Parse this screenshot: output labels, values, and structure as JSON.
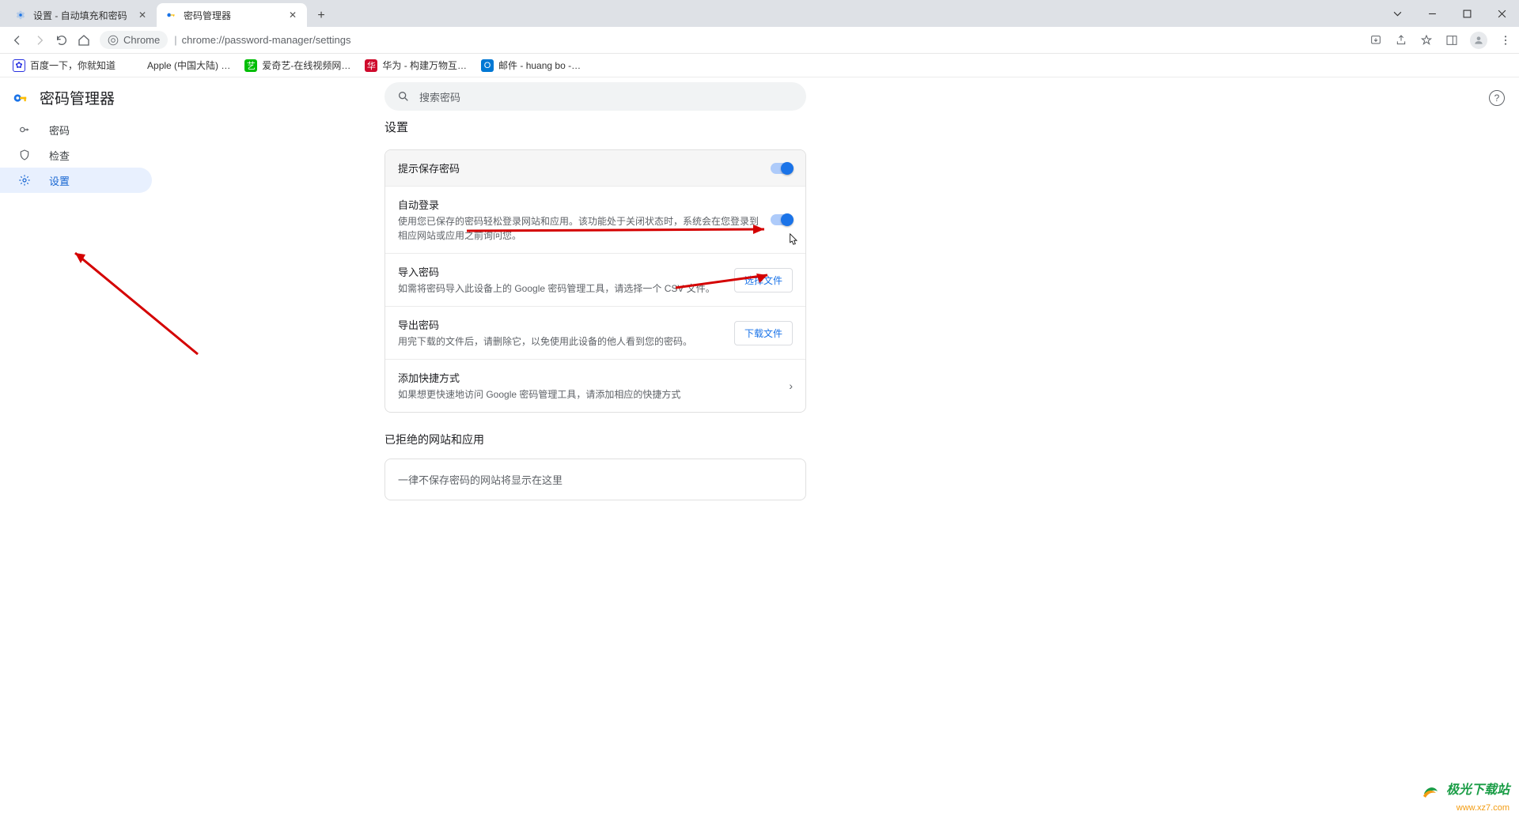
{
  "tabs": [
    {
      "title": "设置 - 自动填充和密码",
      "active": false
    },
    {
      "title": "密码管理器",
      "active": true
    }
  ],
  "omnibox": {
    "chip": "Chrome",
    "url": "chrome://password-manager/settings"
  },
  "bookmarks": [
    {
      "label": "百度一下，你就知道",
      "color": "#2932e1"
    },
    {
      "label": "Apple (中国大陆) …",
      "color": "#999"
    },
    {
      "label": "爱奇艺-在线视频网…",
      "color": "#00be06"
    },
    {
      "label": "华为 - 构建万物互…",
      "color": "#cf0a2c"
    },
    {
      "label": "邮件 - huang bo -…",
      "color": "#0078d4"
    }
  ],
  "app": {
    "title": "密码管理器"
  },
  "search": {
    "placeholder": "搜索密码"
  },
  "sidebar": {
    "items": [
      {
        "label": "密码",
        "icon": "key"
      },
      {
        "label": "检查",
        "icon": "shield"
      },
      {
        "label": "设置",
        "icon": "gear",
        "active": true
      }
    ]
  },
  "main": {
    "section_title": "设置",
    "rows": [
      {
        "title": "提示保存密码",
        "desc": "",
        "control": "toggle",
        "on": true,
        "hover": true
      },
      {
        "title": "自动登录",
        "desc": "使用您已保存的密码轻松登录网站和应用。该功能处于关闭状态时，系统会在您登录到相应网站或应用之前询问您。",
        "control": "toggle",
        "on": true
      },
      {
        "title": "导入密码",
        "desc": "如需将密码导入此设备上的 Google 密码管理工具，请选择一个 CSV 文件。",
        "control": "button",
        "btn": "选择文件"
      },
      {
        "title": "导出密码",
        "desc": "用完下载的文件后，请删除它，以免使用此设备的他人看到您的密码。",
        "control": "button",
        "btn": "下载文件"
      },
      {
        "title": "添加快捷方式",
        "desc": "如果想更快速地访问 Google 密码管理工具，请添加相应的快捷方式",
        "control": "chevron"
      }
    ],
    "declined_title": "已拒绝的网站和应用",
    "declined_empty": "一律不保存密码的网站将显示在这里"
  },
  "watermark": {
    "line1": "极光下载站",
    "line2": "www.xz7.com"
  }
}
